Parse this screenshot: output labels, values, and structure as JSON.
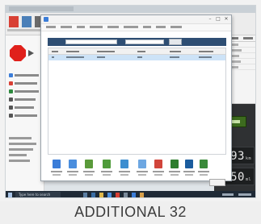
{
  "dialog": {
    "controls": {
      "minimize": "–",
      "maximize": "□",
      "close": "✕"
    },
    "launchers": [
      {
        "icon": "document-icon",
        "color": "#3b7dd8"
      },
      {
        "icon": "document-icon",
        "color": "#4a8ede"
      },
      {
        "icon": "folder-icon",
        "color": "#5a9a3a"
      },
      {
        "icon": "money-icon",
        "color": "#4f9b3a"
      },
      {
        "icon": "people-icon",
        "color": "#3d8ed0"
      },
      {
        "icon": "document-icon",
        "color": "#6da7e2"
      },
      {
        "icon": "chart-icon",
        "color": "#d1453b"
      },
      {
        "icon": "book-icon",
        "color": "#2d7d2d"
      },
      {
        "icon": "book-icon",
        "color": "#1b5c9e"
      },
      {
        "icon": "book-icon",
        "color": "#3a8a3a"
      }
    ]
  },
  "gauges": [
    {
      "value": "193",
      "unit": "km"
    },
    {
      "value": "550",
      "unit": "ml"
    }
  ],
  "taskbar": {
    "search_placeholder": "Type here to search"
  },
  "caption": {
    "text": "ADDITIONAL 32"
  },
  "colors": {
    "stop_sign": "#e0201b",
    "search_bar": "#2e4e73",
    "selected_row": "#cde3f7",
    "taskbar": "#1f2a36"
  }
}
